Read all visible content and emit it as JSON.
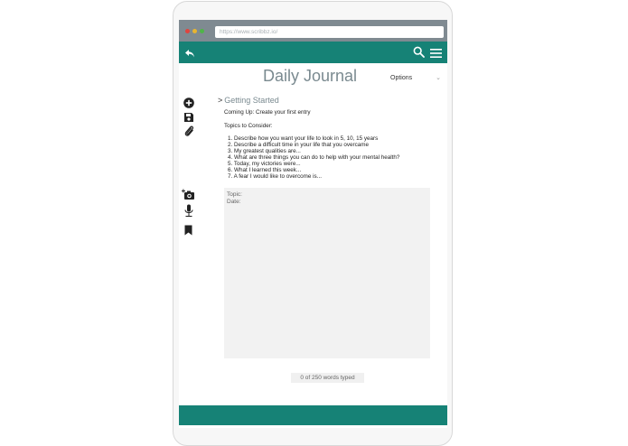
{
  "browser": {
    "url": "https://www.scribbz.io/"
  },
  "page": {
    "title": "Daily Journal",
    "options_label": "Options"
  },
  "section": {
    "title": "Getting Started",
    "coming_up": "Coming Up: Create your first entry",
    "topics_heading": "Topics to Consider:",
    "topics": [
      "1. Describe how you want your life to look in 5, 10, 15 years",
      "2. Describe a difficult time in your life that you overcame",
      "3. My greatest qualities are...",
      "4. What are three things you can do to help with your mental health?",
      "5. Today, my victories were...",
      "6. What I learned this week...",
      "7. A fear I would like to overcome is..."
    ]
  },
  "editor": {
    "topic_label": "Topic:",
    "date_label": "Date:"
  },
  "counter": {
    "text": "0 of 250 words typed"
  },
  "icons": {
    "header": [
      "back-arrow-icon",
      "search-icon",
      "menu-icon"
    ],
    "tools_top": [
      "add-circle-icon",
      "save-icon",
      "paperclip-icon"
    ],
    "tools_bottom": [
      "add-photo-icon",
      "microphone-icon",
      "bookmark-icon"
    ]
  },
  "colors": {
    "teal": "#168276",
    "browser_bar": "#7f8a91",
    "title_text": "#7a8a90",
    "editor_bg": "#f2f2f2"
  }
}
